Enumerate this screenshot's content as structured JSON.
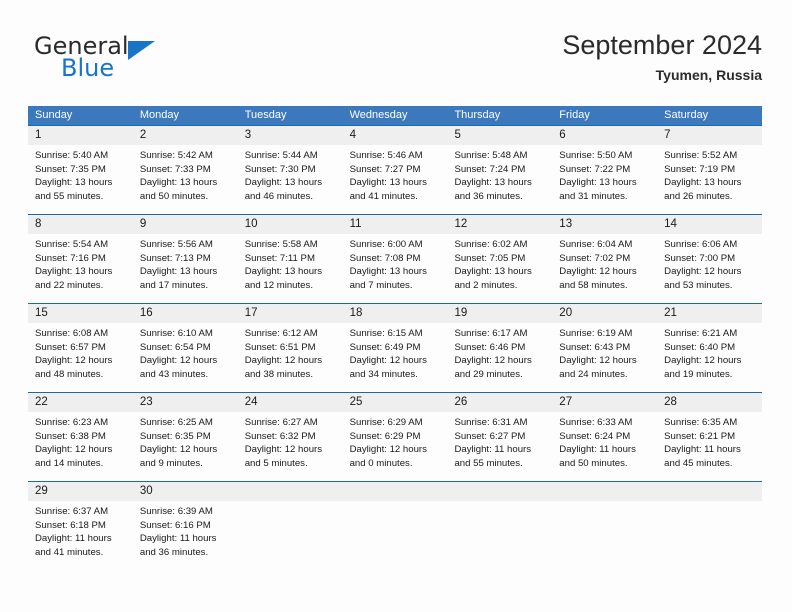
{
  "brand": {
    "name_part1": "General",
    "name_part2": "Blue",
    "triangle_color": "#1874c4"
  },
  "header": {
    "title": "September 2024",
    "subtitle": "Tyumen, Russia"
  },
  "theme": {
    "header_bg": "#3c78bc",
    "header_text": "#ffffff",
    "daynum_bg": "#efefef",
    "week_rule": "#1b68ae",
    "page_bg": "#fdfdfd"
  },
  "weekdays": [
    "Sunday",
    "Monday",
    "Tuesday",
    "Wednesday",
    "Thursday",
    "Friday",
    "Saturday"
  ],
  "weeks": [
    {
      "days": [
        {
          "num": "1",
          "l1": "Sunrise: 5:40 AM",
          "l2": "Sunset: 7:35 PM",
          "l3": "Daylight: 13 hours",
          "l4": "and 55 minutes."
        },
        {
          "num": "2",
          "l1": "Sunrise: 5:42 AM",
          "l2": "Sunset: 7:33 PM",
          "l3": "Daylight: 13 hours",
          "l4": "and 50 minutes."
        },
        {
          "num": "3",
          "l1": "Sunrise: 5:44 AM",
          "l2": "Sunset: 7:30 PM",
          "l3": "Daylight: 13 hours",
          "l4": "and 46 minutes."
        },
        {
          "num": "4",
          "l1": "Sunrise: 5:46 AM",
          "l2": "Sunset: 7:27 PM",
          "l3": "Daylight: 13 hours",
          "l4": "and 41 minutes."
        },
        {
          "num": "5",
          "l1": "Sunrise: 5:48 AM",
          "l2": "Sunset: 7:24 PM",
          "l3": "Daylight: 13 hours",
          "l4": "and 36 minutes."
        },
        {
          "num": "6",
          "l1": "Sunrise: 5:50 AM",
          "l2": "Sunset: 7:22 PM",
          "l3": "Daylight: 13 hours",
          "l4": "and 31 minutes."
        },
        {
          "num": "7",
          "l1": "Sunrise: 5:52 AM",
          "l2": "Sunset: 7:19 PM",
          "l3": "Daylight: 13 hours",
          "l4": "and 26 minutes."
        }
      ]
    },
    {
      "days": [
        {
          "num": "8",
          "l1": "Sunrise: 5:54 AM",
          "l2": "Sunset: 7:16 PM",
          "l3": "Daylight: 13 hours",
          "l4": "and 22 minutes."
        },
        {
          "num": "9",
          "l1": "Sunrise: 5:56 AM",
          "l2": "Sunset: 7:13 PM",
          "l3": "Daylight: 13 hours",
          "l4": "and 17 minutes."
        },
        {
          "num": "10",
          "l1": "Sunrise: 5:58 AM",
          "l2": "Sunset: 7:11 PM",
          "l3": "Daylight: 13 hours",
          "l4": "and 12 minutes."
        },
        {
          "num": "11",
          "l1": "Sunrise: 6:00 AM",
          "l2": "Sunset: 7:08 PM",
          "l3": "Daylight: 13 hours",
          "l4": "and 7 minutes."
        },
        {
          "num": "12",
          "l1": "Sunrise: 6:02 AM",
          "l2": "Sunset: 7:05 PM",
          "l3": "Daylight: 13 hours",
          "l4": "and 2 minutes."
        },
        {
          "num": "13",
          "l1": "Sunrise: 6:04 AM",
          "l2": "Sunset: 7:02 PM",
          "l3": "Daylight: 12 hours",
          "l4": "and 58 minutes."
        },
        {
          "num": "14",
          "l1": "Sunrise: 6:06 AM",
          "l2": "Sunset: 7:00 PM",
          "l3": "Daylight: 12 hours",
          "l4": "and 53 minutes."
        }
      ]
    },
    {
      "days": [
        {
          "num": "15",
          "l1": "Sunrise: 6:08 AM",
          "l2": "Sunset: 6:57 PM",
          "l3": "Daylight: 12 hours",
          "l4": "and 48 minutes."
        },
        {
          "num": "16",
          "l1": "Sunrise: 6:10 AM",
          "l2": "Sunset: 6:54 PM",
          "l3": "Daylight: 12 hours",
          "l4": "and 43 minutes."
        },
        {
          "num": "17",
          "l1": "Sunrise: 6:12 AM",
          "l2": "Sunset: 6:51 PM",
          "l3": "Daylight: 12 hours",
          "l4": "and 38 minutes."
        },
        {
          "num": "18",
          "l1": "Sunrise: 6:15 AM",
          "l2": "Sunset: 6:49 PM",
          "l3": "Daylight: 12 hours",
          "l4": "and 34 minutes."
        },
        {
          "num": "19",
          "l1": "Sunrise: 6:17 AM",
          "l2": "Sunset: 6:46 PM",
          "l3": "Daylight: 12 hours",
          "l4": "and 29 minutes."
        },
        {
          "num": "20",
          "l1": "Sunrise: 6:19 AM",
          "l2": "Sunset: 6:43 PM",
          "l3": "Daylight: 12 hours",
          "l4": "and 24 minutes."
        },
        {
          "num": "21",
          "l1": "Sunrise: 6:21 AM",
          "l2": "Sunset: 6:40 PM",
          "l3": "Daylight: 12 hours",
          "l4": "and 19 minutes."
        }
      ]
    },
    {
      "days": [
        {
          "num": "22",
          "l1": "Sunrise: 6:23 AM",
          "l2": "Sunset: 6:38 PM",
          "l3": "Daylight: 12 hours",
          "l4": "and 14 minutes."
        },
        {
          "num": "23",
          "l1": "Sunrise: 6:25 AM",
          "l2": "Sunset: 6:35 PM",
          "l3": "Daylight: 12 hours",
          "l4": "and 9 minutes."
        },
        {
          "num": "24",
          "l1": "Sunrise: 6:27 AM",
          "l2": "Sunset: 6:32 PM",
          "l3": "Daylight: 12 hours",
          "l4": "and 5 minutes."
        },
        {
          "num": "25",
          "l1": "Sunrise: 6:29 AM",
          "l2": "Sunset: 6:29 PM",
          "l3": "Daylight: 12 hours",
          "l4": "and 0 minutes."
        },
        {
          "num": "26",
          "l1": "Sunrise: 6:31 AM",
          "l2": "Sunset: 6:27 PM",
          "l3": "Daylight: 11 hours",
          "l4": "and 55 minutes."
        },
        {
          "num": "27",
          "l1": "Sunrise: 6:33 AM",
          "l2": "Sunset: 6:24 PM",
          "l3": "Daylight: 11 hours",
          "l4": "and 50 minutes."
        },
        {
          "num": "28",
          "l1": "Sunrise: 6:35 AM",
          "l2": "Sunset: 6:21 PM",
          "l3": "Daylight: 11 hours",
          "l4": "and 45 minutes."
        }
      ]
    },
    {
      "days": [
        {
          "num": "29",
          "l1": "Sunrise: 6:37 AM",
          "l2": "Sunset: 6:18 PM",
          "l3": "Daylight: 11 hours",
          "l4": "and 41 minutes."
        },
        {
          "num": "30",
          "l1": "Sunrise: 6:39 AM",
          "l2": "Sunset: 6:16 PM",
          "l3": "Daylight: 11 hours",
          "l4": "and 36 minutes."
        },
        {
          "num": "",
          "l1": "",
          "l2": "",
          "l3": "",
          "l4": ""
        },
        {
          "num": "",
          "l1": "",
          "l2": "",
          "l3": "",
          "l4": ""
        },
        {
          "num": "",
          "l1": "",
          "l2": "",
          "l3": "",
          "l4": ""
        },
        {
          "num": "",
          "l1": "",
          "l2": "",
          "l3": "",
          "l4": ""
        },
        {
          "num": "",
          "l1": "",
          "l2": "",
          "l3": "",
          "l4": ""
        }
      ]
    }
  ]
}
